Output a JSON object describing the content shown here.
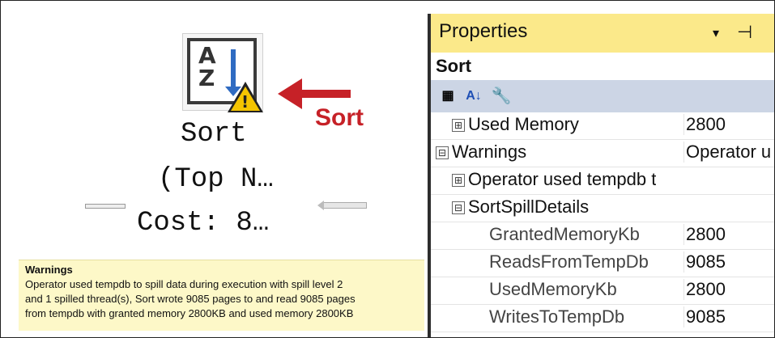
{
  "plan": {
    "node_name": "Sort",
    "node_subtitle": "(Top N…",
    "node_cost": "Cost: 8…",
    "annotation_label": "Sort",
    "icon": "sort-az-warning-icon",
    "annotation_color": "#c62127",
    "warning_color": "#f4c400"
  },
  "tooltip": {
    "title": "Warnings",
    "lines": [
      "Operator used tempdb to spill data during execution with spill level 2",
      "and 1 spilled thread(s), Sort wrote 9085 pages to and read 9085 pages",
      "from tempdb with granted memory 2800KB and used memory 2800KB"
    ],
    "background": "#fdf8c8"
  },
  "properties": {
    "title": "Properties",
    "dropdown_glyph": "▾",
    "pin_glyph": "⊣",
    "object": "Sort",
    "title_background": "#fbe98a",
    "toolbar_background": "#ccd5e5",
    "toolbar": {
      "categorized_icon": "categorized-icon",
      "alphabetical_icon": "alphabetical-sort-icon",
      "property_pages_icon": "wrench-icon"
    },
    "rows": [
      {
        "toggle": "⊞",
        "name": "Used Memory",
        "value": "2800",
        "indent": 1
      },
      {
        "toggle": "⊟",
        "name": "Warnings",
        "value": "Operator u",
        "indent": 0
      },
      {
        "toggle": "⊞",
        "name": "Operator used tempdb t",
        "value": "",
        "indent": 1
      },
      {
        "toggle": "⊟",
        "name": "SortSpillDetails",
        "value": "",
        "indent": 1
      },
      {
        "toggle": "",
        "name": "GrantedMemoryKb",
        "value": "2800",
        "indent": 2
      },
      {
        "toggle": "",
        "name": "ReadsFromTempDb",
        "value": "9085",
        "indent": 2
      },
      {
        "toggle": "",
        "name": "UsedMemoryKb",
        "value": "2800",
        "indent": 2
      },
      {
        "toggle": "",
        "name": "WritesToTempDb",
        "value": "9085",
        "indent": 2
      }
    ]
  }
}
